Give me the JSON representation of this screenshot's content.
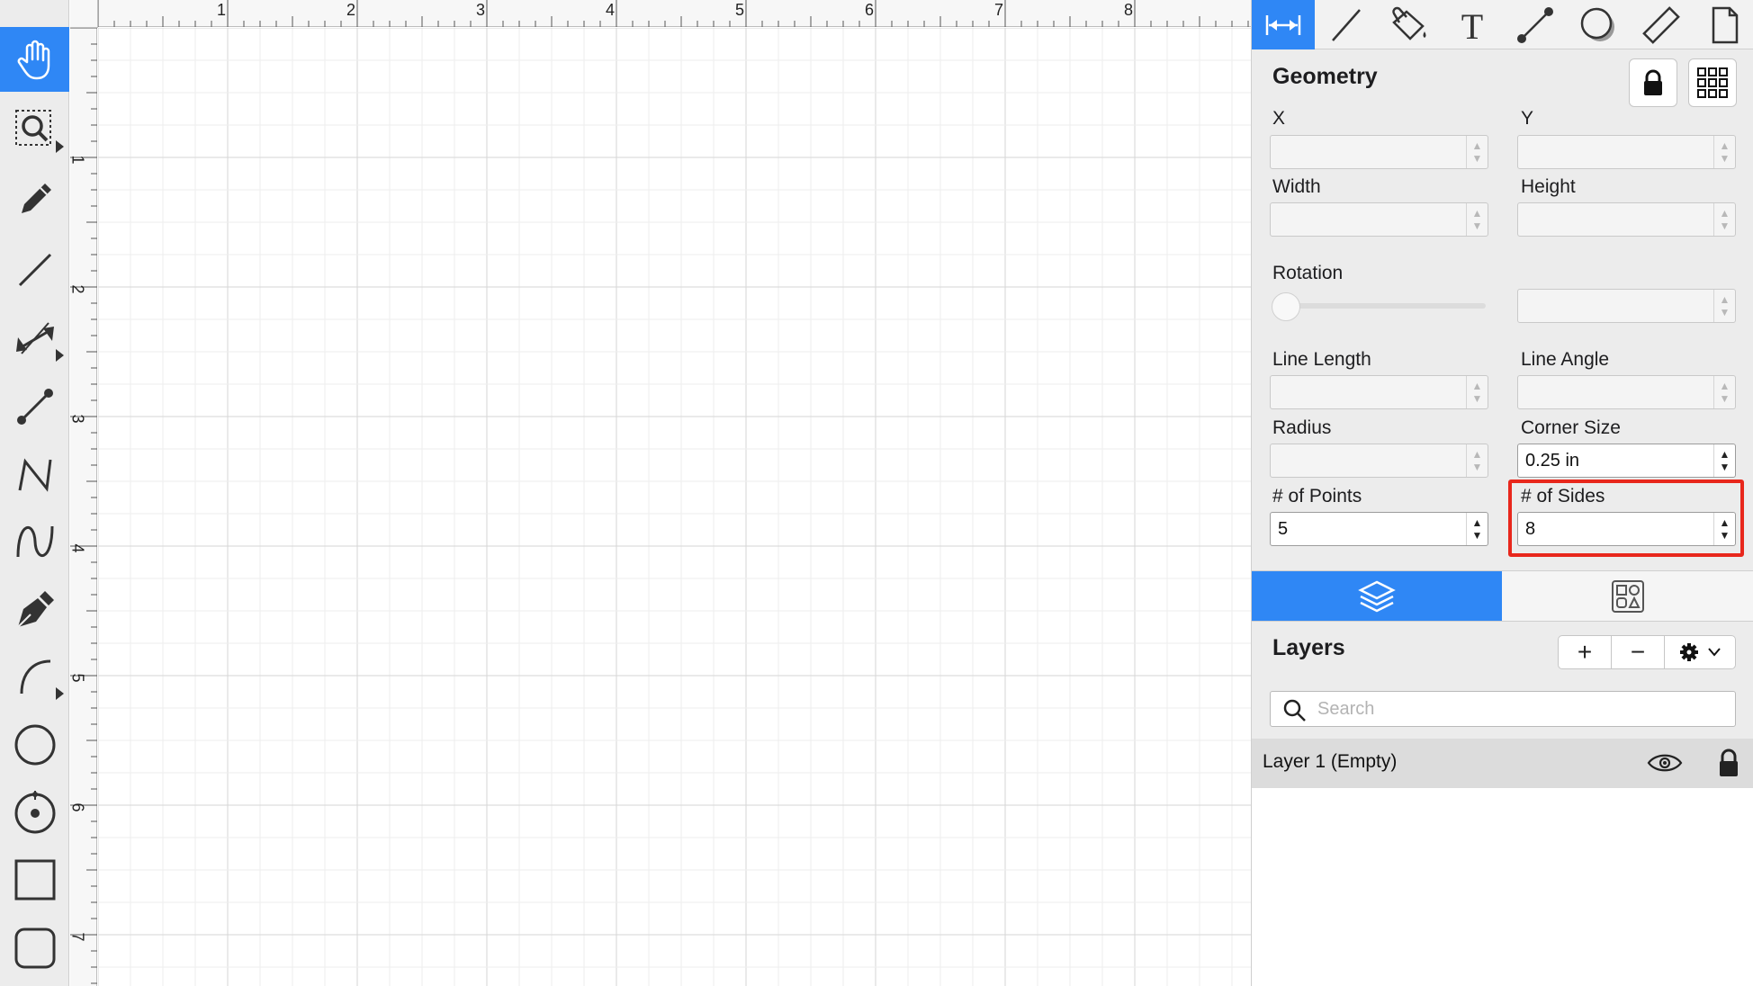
{
  "toolbar": {
    "tools": [
      {
        "name": "hand-icon",
        "active": true
      },
      {
        "name": "zoom-icon"
      },
      {
        "name": "pencil-icon"
      },
      {
        "name": "line-icon"
      },
      {
        "name": "dimension-icon"
      },
      {
        "name": "connector-icon"
      },
      {
        "name": "polyline-icon"
      },
      {
        "name": "curve-icon"
      },
      {
        "name": "pen-icon"
      },
      {
        "name": "arc-icon"
      },
      {
        "name": "ellipse-icon"
      },
      {
        "name": "circle-center-icon"
      },
      {
        "name": "rectangle-icon"
      },
      {
        "name": "rounded-rectangle-icon"
      }
    ]
  },
  "canvas": {
    "ruler_top": [
      "1",
      "2",
      "3",
      "4",
      "5",
      "6",
      "7",
      "8"
    ],
    "ruler_left": [
      "1",
      "2",
      "3",
      "4",
      "5",
      "6",
      "7"
    ]
  },
  "inspector": {
    "tabs": [
      "dimensions-icon",
      "line-style-icon",
      "fill-icon",
      "text-icon",
      "connection-icon",
      "shadow-icon",
      "ruler-icon",
      "document-icon"
    ],
    "geometry": {
      "title": "Geometry",
      "x_label": "X",
      "y_label": "Y",
      "width_label": "Width",
      "height_label": "Height",
      "rotation_label": "Rotation",
      "line_length_label": "Line Length",
      "line_angle_label": "Line Angle",
      "radius_label": "Radius",
      "corner_size_label": "Corner Size",
      "corner_size_value": "0.25 in",
      "points_label": "# of Points",
      "points_value": "5",
      "sides_label": "# of Sides",
      "sides_value": "8"
    },
    "layers": {
      "title": "Layers",
      "add": "+",
      "remove": "−",
      "search_placeholder": "Search",
      "rows": [
        {
          "label": "Layer 1 (Empty)"
        }
      ]
    }
  },
  "accent_color": "#2f87f5",
  "highlight_color": "#e8271c"
}
